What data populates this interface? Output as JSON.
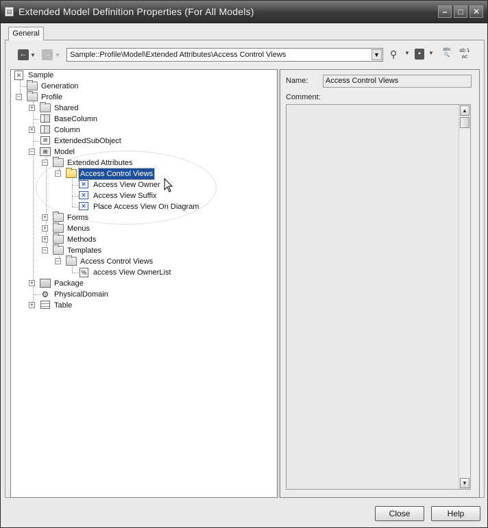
{
  "window": {
    "title": "Extended Model Definition Properties (For All Models)"
  },
  "tabs": [
    {
      "label": "General"
    }
  ],
  "toolbar": {
    "path": "Sample::Profile\\Model\\Extended Attributes\\Access Control Views"
  },
  "tree": {
    "root": "Sample",
    "generation": "Generation",
    "profile": "Profile",
    "shared": "Shared",
    "base_column": "BaseColumn",
    "column": "Column",
    "extended_sub_object": "ExtendedSubObject",
    "model": "Model",
    "extended_attributes": "Extended Attributes",
    "access_control_views": "Access Control Views",
    "attr_owner": "Access View Owner",
    "attr_suffix": "Access View Suffix",
    "attr_place": "Place Access View On Diagram",
    "forms": "Forms",
    "menus": "Menus",
    "methods": "Methods",
    "templates": "Templates",
    "tpl_access_control_views": "Access Control Views",
    "tpl_owner_list": "access View OwnerList",
    "package": "Package",
    "physical_domain": "PhysicalDomain",
    "table": "Table"
  },
  "properties": {
    "name_label": "Name:",
    "name_value": "Access Control Views",
    "comment_label": "Comment:"
  },
  "buttons": {
    "close": "Close",
    "help": "Help"
  }
}
